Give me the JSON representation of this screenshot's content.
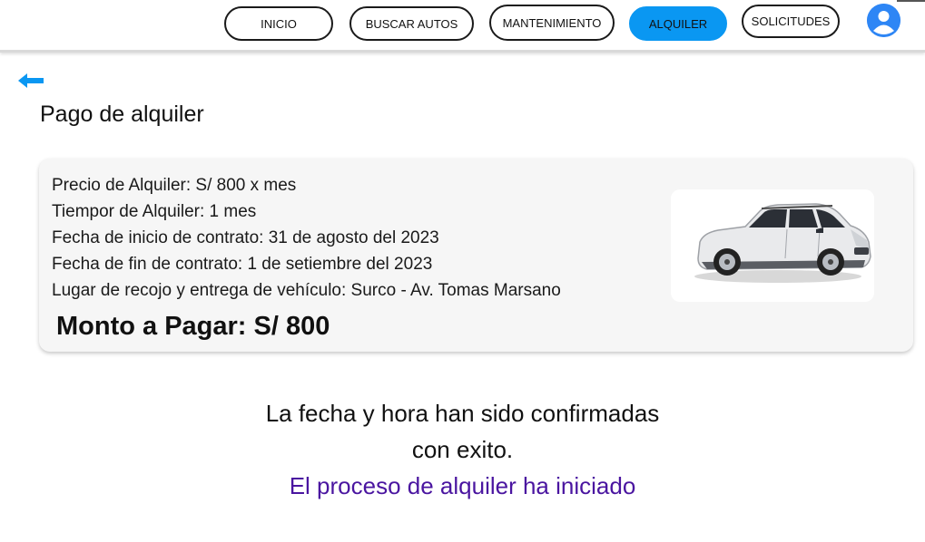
{
  "nav": {
    "items": [
      {
        "label": "INICIO"
      },
      {
        "label": "BUSCAR AUTOS"
      },
      {
        "label": "MANTENIMIENTO"
      },
      {
        "label": "ALQUILER"
      },
      {
        "label": "SOLICITUDES"
      }
    ],
    "active": "ALQUILER",
    "accent_color": "#0a97f2"
  },
  "page": {
    "title": "Pago de alquiler"
  },
  "rental": {
    "price": " Precio de Alquiler:  S/ 800 x mes",
    "duration": "Tiempor de Alquiler: 1 mes",
    "start": "Fecha de inicio de contrato: 31 de agosto del 2023",
    "end": "Fecha de fin de contrato: 1 de setiembre del 2023",
    "location": "Lugar de recojo y entrega de vehículo: Surco - Av. Tomas Marsano",
    "total": "Monto a Pagar:  S/ 800"
  },
  "confirmation": {
    "line1": "La fecha y hora han sido confirmadas",
    "line2": "con exito.",
    "line3": "El proceso de alquiler ha iniciado",
    "line3_color": "#4a15a0"
  },
  "icons": {
    "back": "arrow-left-icon",
    "user": "user-avatar-icon",
    "car": "car-image"
  }
}
